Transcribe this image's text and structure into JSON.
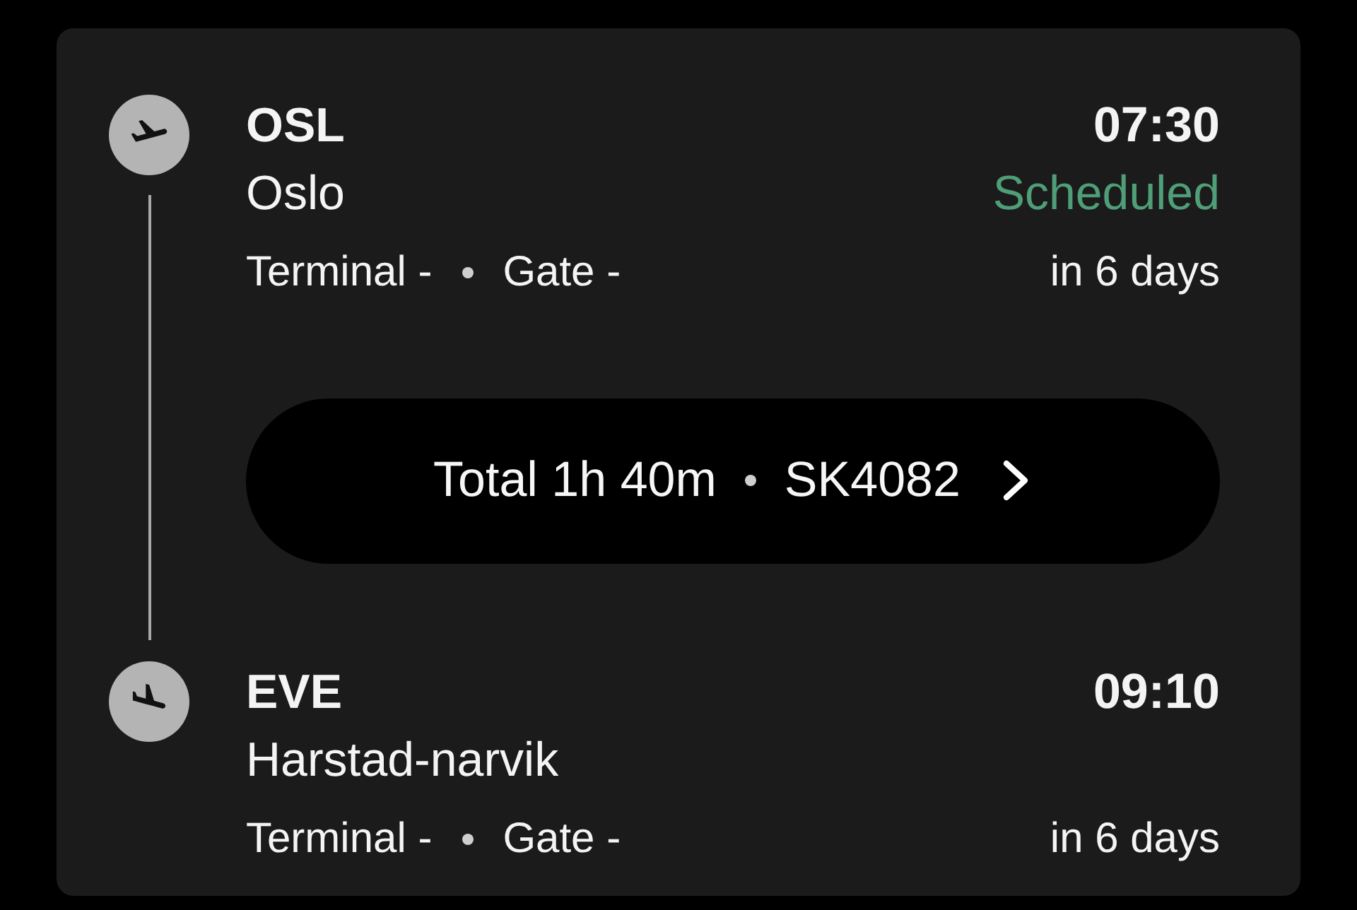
{
  "legs": [
    {
      "kind": "departure",
      "airport_code": "OSL",
      "city": "Oslo",
      "terminal": "Terminal -",
      "gate": "Gate -",
      "time": "07:30",
      "status": "Scheduled",
      "relative_day": "in 6 days"
    },
    {
      "kind": "arrival",
      "airport_code": "EVE",
      "city": "Harstad-narvik",
      "terminal": "Terminal -",
      "gate": "Gate -",
      "time": "09:10",
      "relative_day": "in 6 days"
    }
  ],
  "summary": {
    "duration": "Total 1h 40m",
    "flight_number": "SK4082"
  }
}
